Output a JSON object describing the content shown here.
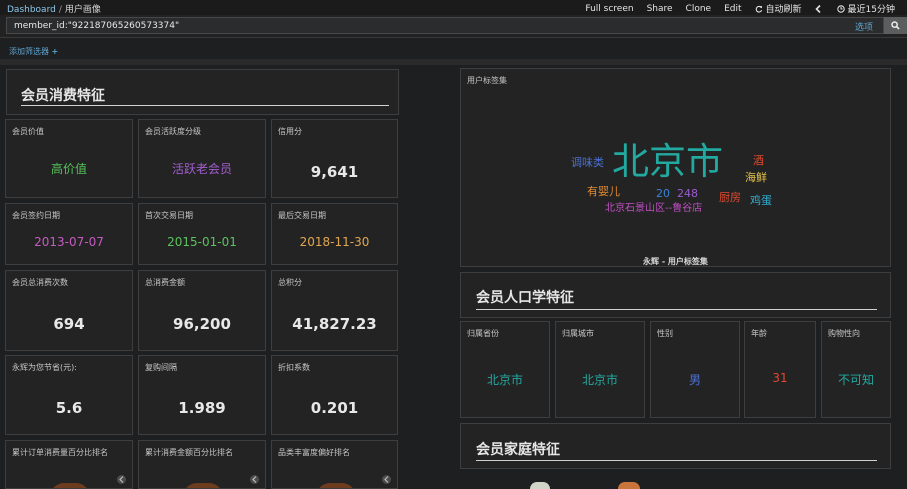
{
  "nav": {
    "breadcrumb_root": "Dashboard",
    "breadcrumb_sep": "/",
    "breadcrumb_current": "用户画像",
    "menu": {
      "full_screen": "Full screen",
      "share": "Share",
      "clone": "Clone",
      "edit": "Edit",
      "auto_refresh": "自动刷新",
      "time_range": "最近15分钟"
    }
  },
  "search": {
    "query": "member_id:\"922187065260573374\"",
    "options_label": "选项"
  },
  "filters": {
    "add_label": "添加筛选器"
  },
  "consumption": {
    "heading": "会员消费特征",
    "metrics": [
      {
        "title": "会员价值",
        "value": "高价值",
        "color": "#57c15a"
      },
      {
        "title": "会员活跃度分级",
        "value": "活跃老会员",
        "color": "#a35dd0"
      },
      {
        "title": "信用分",
        "value": "9,641",
        "color": "#e8e8e8"
      },
      {
        "title": "会员签约日期",
        "value": "2013-07-07",
        "color": "#c65ac2"
      },
      {
        "title": "首次交易日期",
        "value": "2015-01-01",
        "color": "#5cc15e"
      },
      {
        "title": "最后交易日期",
        "value": "2018-11-30",
        "color": "#e0a64f"
      },
      {
        "title": "会员总消费次数",
        "value": "694",
        "color": "#e8e8e8"
      },
      {
        "title": "总消费金额",
        "value": "96,200",
        "color": "#e8e8e8"
      },
      {
        "title": "总积分",
        "value": "41,827.23",
        "color": "#e8e8e8"
      },
      {
        "title": "永辉为您节省(元):",
        "value": "5.6",
        "color": "#e8e8e8"
      },
      {
        "title": "复购间隔",
        "value": "1.989",
        "color": "#e8e8e8"
      },
      {
        "title": "折扣系数",
        "value": "0.201",
        "color": "#e8e8e8"
      },
      {
        "title": "累计订单消费量百分比排名",
        "value": "",
        "color": "#e8e8e8"
      },
      {
        "title": "累计消费金额百分比排名",
        "value": "",
        "color": "#e8e8e8"
      },
      {
        "title": "品类丰富度偏好排名",
        "value": "",
        "color": "#e8e8e8"
      }
    ]
  },
  "tags": {
    "title": "用户标签集",
    "caption": "永辉 - 用户标签集",
    "words": [
      {
        "text": "北京市",
        "color": "#22a9a0"
      },
      {
        "text": "调味类",
        "color": "#4c72d6"
      },
      {
        "text": "酒",
        "color": "#e0492f"
      },
      {
        "text": "海鲜",
        "color": "#e4c34b"
      },
      {
        "text": "有婴儿",
        "color": "#e28a2f"
      },
      {
        "text": "20",
        "color": "#3a83d6"
      },
      {
        "text": "248",
        "color": "#9c5ad0"
      },
      {
        "text": "厨房",
        "color": "#e0492f"
      },
      {
        "text": "鸡蛋",
        "color": "#2fb0d4"
      },
      {
        "text": "北京石景山区--鲁谷店",
        "color": "#c24fc6"
      }
    ]
  },
  "demographics": {
    "heading": "会员人口学特征",
    "metrics": [
      {
        "title": "归属省份",
        "value": "北京市",
        "color": "#22a9a0"
      },
      {
        "title": "归属城市",
        "value": "北京市",
        "color": "#22a9a0"
      },
      {
        "title": "性别",
        "value": "男",
        "color": "#4c72d6"
      },
      {
        "title": "年龄",
        "value": "31",
        "color": "#e0492f"
      },
      {
        "title": "购物性向",
        "value": "不可知",
        "color": "#22a9a0"
      }
    ]
  },
  "family": {
    "heading": "会员家庭特征"
  }
}
